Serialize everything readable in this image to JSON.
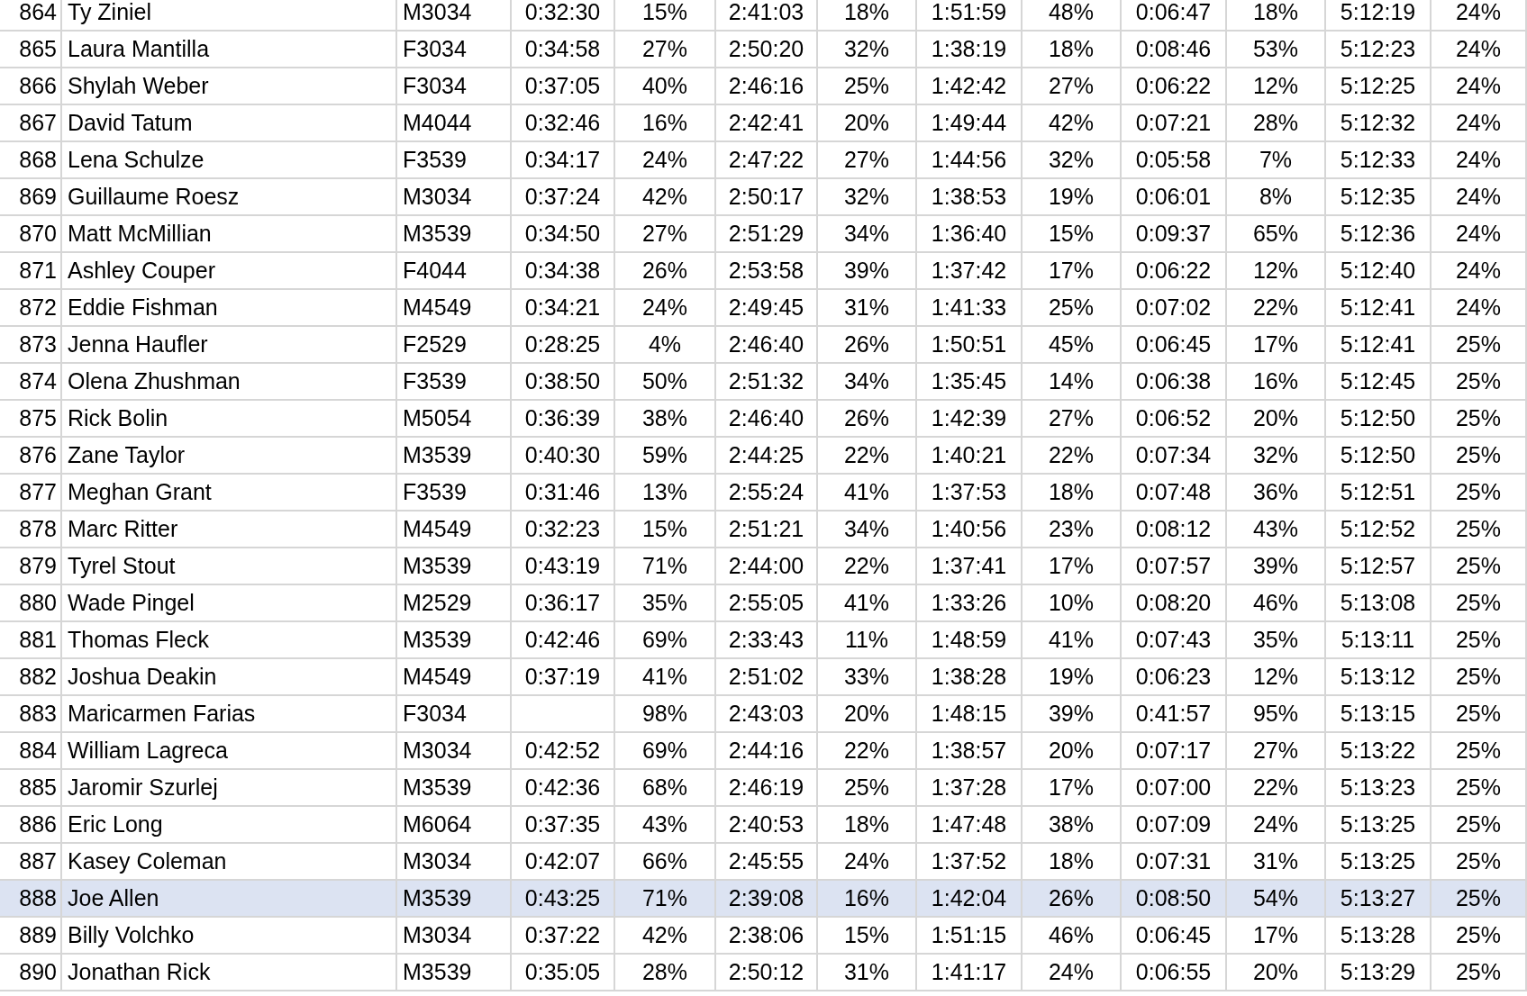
{
  "rows": [
    {
      "selected": false,
      "cells": [
        "864",
        "Ty Ziniel",
        "M3034",
        "0:32:30",
        "15%",
        "2:41:03",
        "18%",
        "1:51:59",
        "48%",
        "0:06:47",
        "18%",
        "5:12:19",
        "24%"
      ]
    },
    {
      "selected": false,
      "cells": [
        "865",
        "Laura Mantilla",
        "F3034",
        "0:34:58",
        "27%",
        "2:50:20",
        "32%",
        "1:38:19",
        "18%",
        "0:08:46",
        "53%",
        "5:12:23",
        "24%"
      ]
    },
    {
      "selected": false,
      "cells": [
        "866",
        "Shylah Weber",
        "F3034",
        "0:37:05",
        "40%",
        "2:46:16",
        "25%",
        "1:42:42",
        "27%",
        "0:06:22",
        "12%",
        "5:12:25",
        "24%"
      ]
    },
    {
      "selected": false,
      "cells": [
        "867",
        "David Tatum",
        "M4044",
        "0:32:46",
        "16%",
        "2:42:41",
        "20%",
        "1:49:44",
        "42%",
        "0:07:21",
        "28%",
        "5:12:32",
        "24%"
      ]
    },
    {
      "selected": false,
      "cells": [
        "868",
        "Lena Schulze",
        "F3539",
        "0:34:17",
        "24%",
        "2:47:22",
        "27%",
        "1:44:56",
        "32%",
        "0:05:58",
        "7%",
        "5:12:33",
        "24%"
      ]
    },
    {
      "selected": false,
      "cells": [
        "869",
        "Guillaume Roesz",
        "M3034",
        "0:37:24",
        "42%",
        "2:50:17",
        "32%",
        "1:38:53",
        "19%",
        "0:06:01",
        "8%",
        "5:12:35",
        "24%"
      ]
    },
    {
      "selected": false,
      "cells": [
        "870",
        "Matt McMillian",
        "M3539",
        "0:34:50",
        "27%",
        "2:51:29",
        "34%",
        "1:36:40",
        "15%",
        "0:09:37",
        "65%",
        "5:12:36",
        "24%"
      ]
    },
    {
      "selected": false,
      "cells": [
        "871",
        "Ashley Couper",
        "F4044",
        "0:34:38",
        "26%",
        "2:53:58",
        "39%",
        "1:37:42",
        "17%",
        "0:06:22",
        "12%",
        "5:12:40",
        "24%"
      ]
    },
    {
      "selected": false,
      "cells": [
        "872",
        "Eddie Fishman",
        "M4549",
        "0:34:21",
        "24%",
        "2:49:45",
        "31%",
        "1:41:33",
        "25%",
        "0:07:02",
        "22%",
        "5:12:41",
        "24%"
      ]
    },
    {
      "selected": false,
      "cells": [
        "873",
        "Jenna Haufler",
        "F2529",
        "0:28:25",
        "4%",
        "2:46:40",
        "26%",
        "1:50:51",
        "45%",
        "0:06:45",
        "17%",
        "5:12:41",
        "25%"
      ]
    },
    {
      "selected": false,
      "cells": [
        "874",
        "Olena Zhushman",
        "F3539",
        "0:38:50",
        "50%",
        "2:51:32",
        "34%",
        "1:35:45",
        "14%",
        "0:06:38",
        "16%",
        "5:12:45",
        "25%"
      ]
    },
    {
      "selected": false,
      "cells": [
        "875",
        "Rick Bolin",
        "M5054",
        "0:36:39",
        "38%",
        "2:46:40",
        "26%",
        "1:42:39",
        "27%",
        "0:06:52",
        "20%",
        "5:12:50",
        "25%"
      ]
    },
    {
      "selected": false,
      "cells": [
        "876",
        "Zane Taylor",
        "M3539",
        "0:40:30",
        "59%",
        "2:44:25",
        "22%",
        "1:40:21",
        "22%",
        "0:07:34",
        "32%",
        "5:12:50",
        "25%"
      ]
    },
    {
      "selected": false,
      "cells": [
        "877",
        "Meghan Grant",
        "F3539",
        "0:31:46",
        "13%",
        "2:55:24",
        "41%",
        "1:37:53",
        "18%",
        "0:07:48",
        "36%",
        "5:12:51",
        "25%"
      ]
    },
    {
      "selected": false,
      "cells": [
        "878",
        "Marc Ritter",
        "M4549",
        "0:32:23",
        "15%",
        "2:51:21",
        "34%",
        "1:40:56",
        "23%",
        "0:08:12",
        "43%",
        "5:12:52",
        "25%"
      ]
    },
    {
      "selected": false,
      "cells": [
        "879",
        "Tyrel Stout",
        "M3539",
        "0:43:19",
        "71%",
        "2:44:00",
        "22%",
        "1:37:41",
        "17%",
        "0:07:57",
        "39%",
        "5:12:57",
        "25%"
      ]
    },
    {
      "selected": false,
      "cells": [
        "880",
        "Wade Pingel",
        "M2529",
        "0:36:17",
        "35%",
        "2:55:05",
        "41%",
        "1:33:26",
        "10%",
        "0:08:20",
        "46%",
        "5:13:08",
        "25%"
      ]
    },
    {
      "selected": false,
      "cells": [
        "881",
        "Thomas Fleck",
        "M3539",
        "0:42:46",
        "69%",
        "2:33:43",
        "11%",
        "1:48:59",
        "41%",
        "0:07:43",
        "35%",
        "5:13:11",
        "25%"
      ]
    },
    {
      "selected": false,
      "cells": [
        "882",
        "Joshua Deakin",
        "M4549",
        "0:37:19",
        "41%",
        "2:51:02",
        "33%",
        "1:38:28",
        "19%",
        "0:06:23",
        "12%",
        "5:13:12",
        "25%"
      ]
    },
    {
      "selected": false,
      "cells": [
        "883",
        "Maricarmen Farias",
        "F3034",
        null,
        "98%",
        "2:43:03",
        "20%",
        "1:48:15",
        "39%",
        "0:41:57",
        "95%",
        "5:13:15",
        "25%"
      ]
    },
    {
      "selected": false,
      "cells": [
        "884",
        "William Lagreca",
        "M3034",
        "0:42:52",
        "69%",
        "2:44:16",
        "22%",
        "1:38:57",
        "20%",
        "0:07:17",
        "27%",
        "5:13:22",
        "25%"
      ]
    },
    {
      "selected": false,
      "cells": [
        "885",
        "Jaromir Szurlej",
        "M3539",
        "0:42:36",
        "68%",
        "2:46:19",
        "25%",
        "1:37:28",
        "17%",
        "0:07:00",
        "22%",
        "5:13:23",
        "25%"
      ]
    },
    {
      "selected": false,
      "cells": [
        "886",
        "Eric Long",
        "M6064",
        "0:37:35",
        "43%",
        "2:40:53",
        "18%",
        "1:47:48",
        "38%",
        "0:07:09",
        "24%",
        "5:13:25",
        "25%"
      ]
    },
    {
      "selected": false,
      "cells": [
        "887",
        "Kasey Coleman",
        "M3034",
        "0:42:07",
        "66%",
        "2:45:55",
        "24%",
        "1:37:52",
        "18%",
        "0:07:31",
        "31%",
        "5:13:25",
        "25%"
      ]
    },
    {
      "selected": true,
      "cells": [
        "888",
        "Joe Allen",
        "M3539",
        "0:43:25",
        "71%",
        "2:39:08",
        "16%",
        "1:42:04",
        "26%",
        "0:08:50",
        "54%",
        "5:13:27",
        "25%"
      ]
    },
    {
      "selected": false,
      "cells": [
        "889",
        "Billy Volchko",
        "M3034",
        "0:37:22",
        "42%",
        "2:38:06",
        "15%",
        "1:51:15",
        "46%",
        "0:06:45",
        "17%",
        "5:13:28",
        "25%"
      ]
    },
    {
      "selected": false,
      "cells": [
        "890",
        "Jonathan Rick",
        "M3539",
        "0:35:05",
        "28%",
        "2:50:12",
        "31%",
        "1:41:17",
        "24%",
        "0:06:55",
        "20%",
        "5:13:29",
        "25%"
      ]
    }
  ]
}
